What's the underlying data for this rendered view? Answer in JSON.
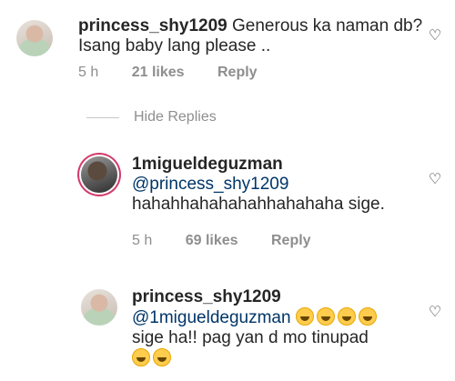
{
  "comments": [
    {
      "username": "princess_shy1209",
      "text": "Generous ka naman db? Isang baby lang please ..",
      "time": "5 h",
      "likes": "21 likes",
      "reply": "Reply"
    },
    {
      "username": "1migueldeguzman",
      "mention": "@princess_shy1209",
      "text": "hahahhahahahahhahahaha sige.",
      "time": "5 h",
      "likes": "69 likes",
      "reply": "Reply"
    },
    {
      "username": "princess_shy1209",
      "mention": "@1migueldeguzman",
      "text": "sige ha!! pag yan d mo tinupad",
      "emoji_name": "grinning-face-with-sweat-emoji"
    }
  ],
  "hide_replies": "Hide Replies",
  "icons": {
    "like": "heart-outline-icon"
  }
}
